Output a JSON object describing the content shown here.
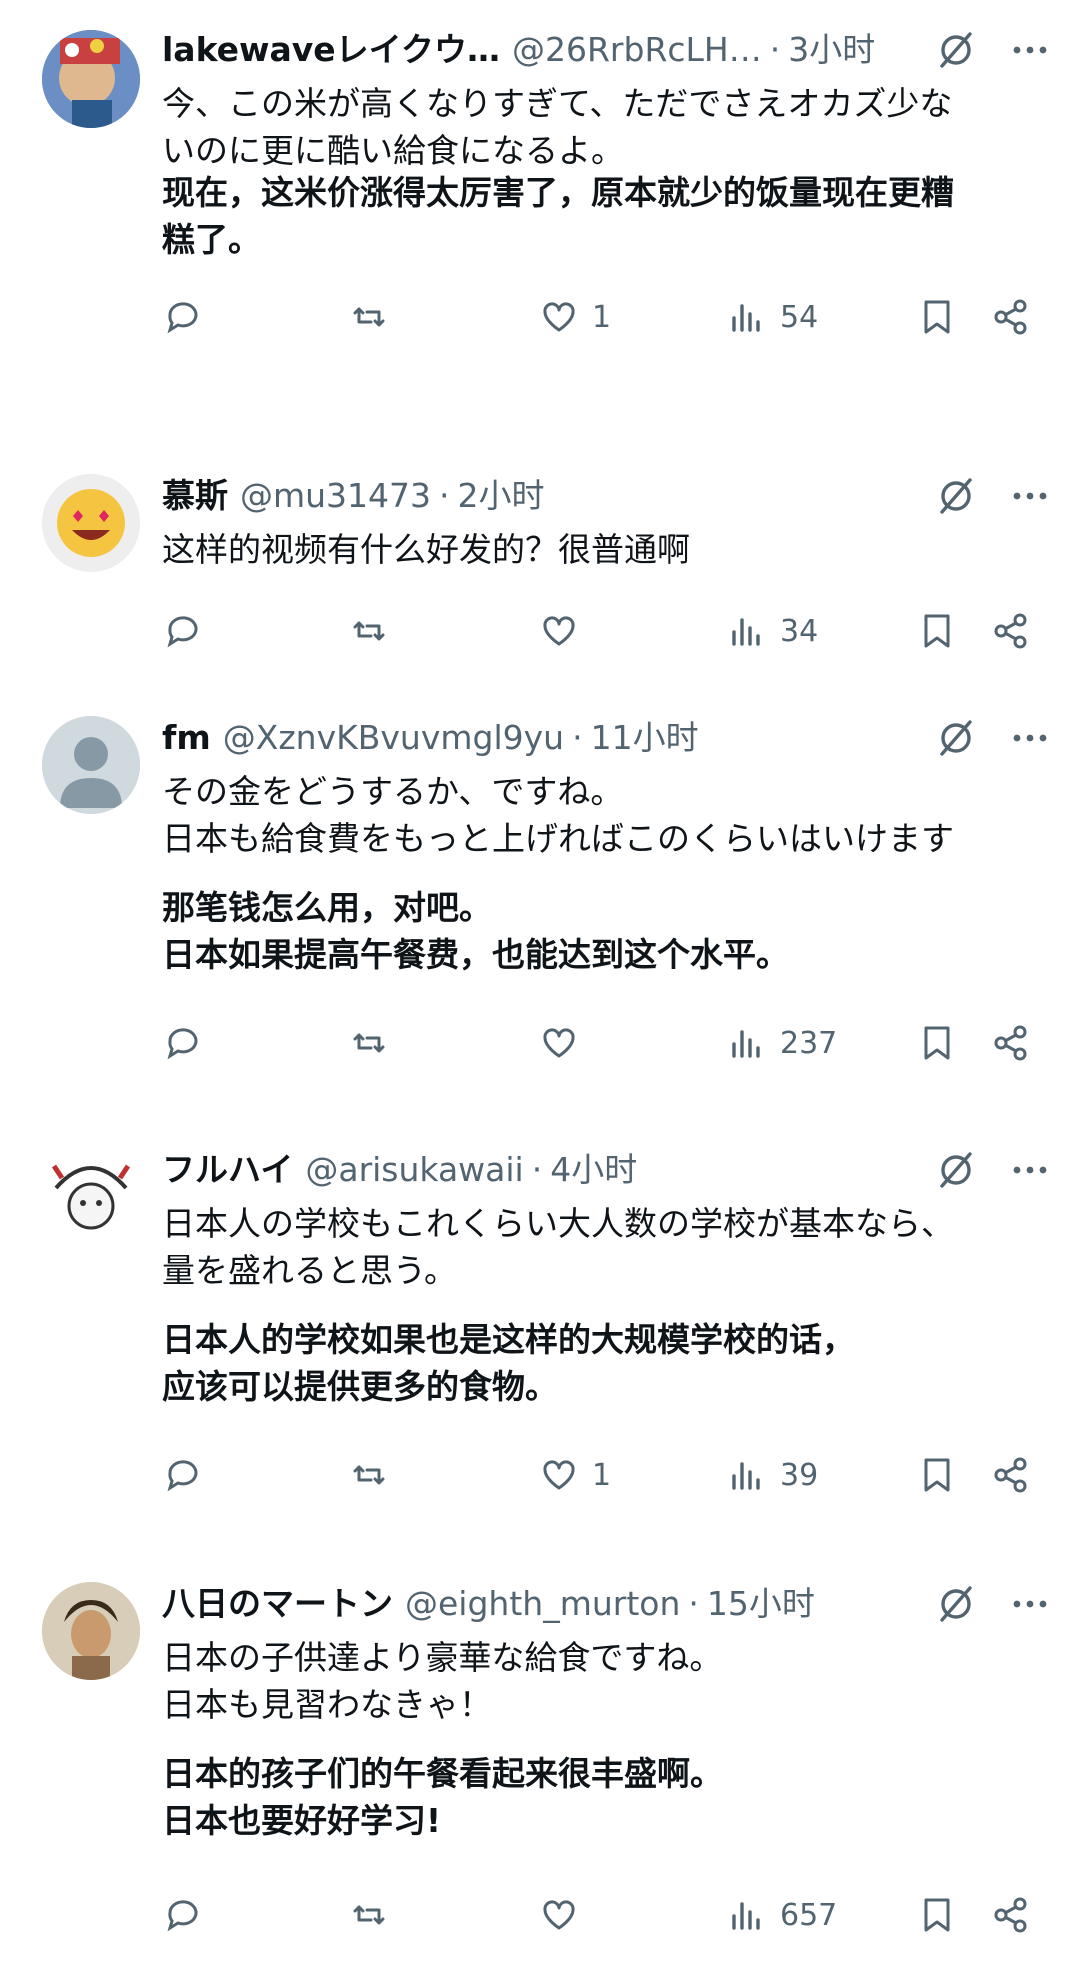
{
  "posts": [
    {
      "name": "lakewaveレイクウ…",
      "handle": "@26RrbRcLH…",
      "sep": "·",
      "time": "3小时",
      "original": [
        "今、この米が高くなりすぎて、ただでさえオカズ少な",
        "いのに更に酷い給食になるよ。"
      ],
      "translation": [
        "现在，这米价涨得太厉害了，原本就少的饭量现在更糟",
        "糕了。"
      ],
      "likes": "1",
      "views": "54"
    },
    {
      "name": "慕斯",
      "handle": "@mu31473",
      "sep": "·",
      "time": "2小时",
      "original": [
        "这样的视频有什么好发的？很普通啊"
      ],
      "translation": [],
      "likes": "",
      "views": "34"
    },
    {
      "name": "fm",
      "handle": "@XznvKBvuvmgl9yu",
      "sep": "·",
      "time": "11小时",
      "original": [
        "その金をどうするか、ですね。",
        "日本も給食費をもっと上げればこのくらいはいけます"
      ],
      "translation": [
        "那笔钱怎么用，对吧。",
        "日本如果提高午餐费，也能达到这个水平。"
      ],
      "likes": "",
      "views": "237"
    },
    {
      "name": "フルハイ",
      "handle": "@arisukawaii",
      "sep": "·",
      "time": "4小时",
      "original": [
        "日本人の学校もこれくらい大人数の学校が基本なら、",
        "量を盛れると思う。"
      ],
      "translation": [
        "日本人的学校如果也是这样的大规模学校的话，",
        "应该可以提供更多的食物。"
      ],
      "likes": "1",
      "views": "39"
    },
    {
      "name": "八日のマートン",
      "handle": "@eighth_murton",
      "sep": "·",
      "time": "15小时",
      "original": [
        "日本の子供達より豪華な給食ですね。",
        "日本も見習わなきゃ！"
      ],
      "translation": [
        "日本的孩子们的午餐看起来很丰盛啊。",
        "日本也要好好学习!"
      ],
      "likes": "",
      "views": "657"
    }
  ],
  "icons": {
    "reply": "reply-icon",
    "repost": "repost-icon",
    "like": "like-icon",
    "views": "views-icon",
    "bookmark": "bookmark-icon",
    "share": "share-icon",
    "grok": "grok-icon",
    "more": "more-icon"
  },
  "colors": {
    "text": "#0f1419",
    "secondary": "#536471",
    "background": "#ffffff"
  }
}
